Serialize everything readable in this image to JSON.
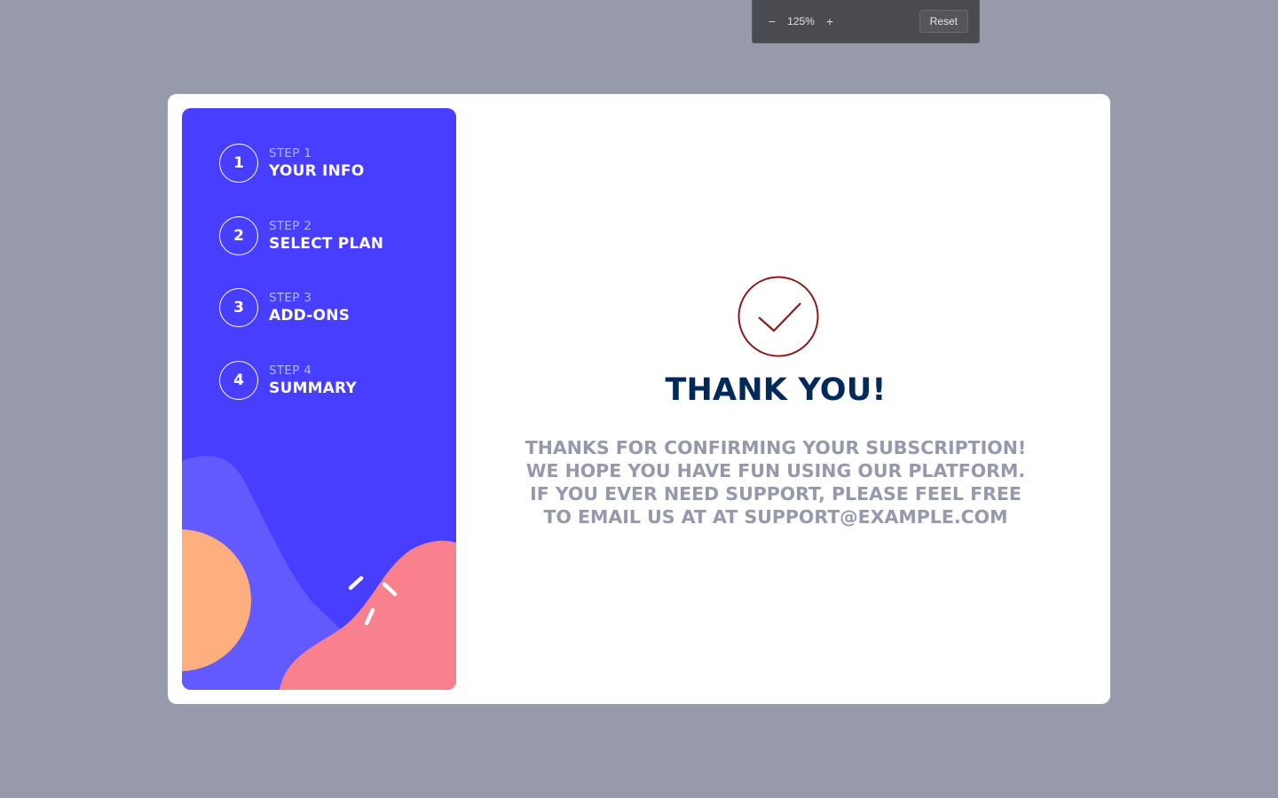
{
  "zoom": {
    "decrease_symbol": "−",
    "level": "125%",
    "increase_symbol": "+",
    "reset_label": "Reset"
  },
  "sidebar": {
    "steps": [
      {
        "number": "1",
        "label": "STEP 1",
        "title": "YOUR INFO"
      },
      {
        "number": "2",
        "label": "STEP 2",
        "title": "SELECT PLAN"
      },
      {
        "number": "3",
        "label": "STEP 3",
        "title": "ADD-ONS"
      },
      {
        "number": "4",
        "label": "STEP 4",
        "title": "SUMMARY"
      }
    ]
  },
  "main": {
    "icon": "checkmark-circle-icon",
    "title": "THANK YOU!",
    "message_lines": [
      "THANKS FOR CONFIRMING YOUR SUBSCRIPTION!",
      "WE HOPE YOU HAVE FUN USING OUR PLATFORM.",
      "IF YOU EVER NEED SUPPORT, PLEASE FEEL FREE",
      "TO EMAIL US AT AT SUPPORT@EXAMPLE.COM"
    ]
  },
  "colors": {
    "page_background": "#969aab",
    "sidebar_background": "#483eff",
    "title_color": "#02295a",
    "message_color": "#9699ab",
    "check_color": "#8b1a1a",
    "blob_purple": "#6259ff",
    "blob_orange": "#ffaf7e",
    "blob_pink": "#f9818e"
  }
}
